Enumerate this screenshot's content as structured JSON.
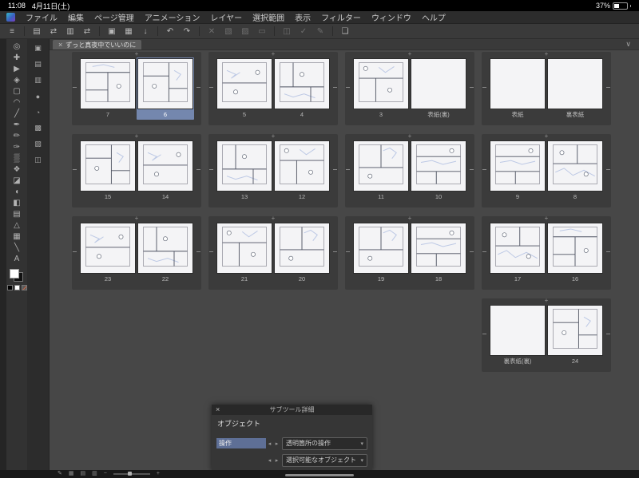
{
  "status_bar": {
    "time": "11:08",
    "date": "4月11日(土)",
    "battery": "37%"
  },
  "menu": {
    "items": [
      "ファイル",
      "編集",
      "ページ管理",
      "アニメーション",
      "レイヤー",
      "選択範囲",
      "表示",
      "フィルター",
      "ウィンドウ",
      "ヘルプ"
    ]
  },
  "toolbar": {
    "buttons": [
      {
        "name": "main-menu-button",
        "glyph": "≡"
      },
      {
        "sep": true
      },
      {
        "name": "spread-view-button",
        "glyph": "▤"
      },
      {
        "name": "change-page-order-button",
        "glyph": "⇄"
      },
      {
        "name": "single-page-view-button",
        "glyph": "▥"
      },
      {
        "name": "reverse-binding-button",
        "glyph": "⇄"
      },
      {
        "sep": true
      },
      {
        "name": "new-page-button",
        "glyph": "▣"
      },
      {
        "name": "import-page-button",
        "glyph": "▦"
      },
      {
        "name": "export-page-button",
        "glyph": "↓"
      },
      {
        "sep": true
      },
      {
        "name": "undo-button",
        "glyph": "↶"
      },
      {
        "name": "redo-button",
        "glyph": "↷"
      },
      {
        "sep": true
      },
      {
        "name": "clear-button",
        "glyph": "✕",
        "dim": true
      },
      {
        "name": "deselect-button",
        "glyph": "▧",
        "dim": true
      },
      {
        "name": "invert-selection-button",
        "glyph": "▨",
        "dim": true
      },
      {
        "name": "crop-button",
        "glyph": "▭",
        "dim": true
      },
      {
        "sep": true
      },
      {
        "name": "snap-to-ruler-button",
        "glyph": "◫",
        "dim": true
      },
      {
        "name": "correct-line-button",
        "glyph": "✓",
        "dim": true
      },
      {
        "name": "vector-edit-button",
        "glyph": "✎",
        "dim": true
      },
      {
        "sep": true
      },
      {
        "name": "material-palette-button",
        "glyph": "❏"
      }
    ]
  },
  "document_tab": {
    "close_glyph": "×",
    "title": "ずっと真夜中でいいのに"
  },
  "tools": {
    "primary": [
      {
        "name": "zoom-tool",
        "glyph": "◎"
      },
      {
        "name": "move-tool",
        "glyph": "✚"
      },
      {
        "name": "object-tool",
        "glyph": "▶"
      },
      {
        "name": "layer-select-tool",
        "glyph": "◈"
      },
      {
        "name": "selection-tool",
        "glyph": "▢"
      },
      {
        "name": "lasso-tool",
        "glyph": "◠"
      },
      {
        "name": "eyedropper-tool",
        "glyph": "╱"
      },
      {
        "name": "pen-tool",
        "glyph": "✒"
      },
      {
        "name": "pencil-tool",
        "glyph": "✏"
      },
      {
        "name": "brush-tool",
        "glyph": "✑"
      },
      {
        "name": "airbrush-tool",
        "glyph": "▒"
      },
      {
        "name": "decoration-tool",
        "glyph": "❖"
      },
      {
        "name": "eraser-tool",
        "glyph": "◪"
      },
      {
        "name": "blend-tool",
        "glyph": "◖"
      },
      {
        "name": "fill-tool",
        "glyph": "◧"
      },
      {
        "name": "gradient-tool",
        "glyph": "▤"
      },
      {
        "name": "figure-tool",
        "glyph": "△"
      },
      {
        "name": "frame-border-tool",
        "glyph": "▦"
      },
      {
        "name": "ruler-tool",
        "glyph": "╲"
      },
      {
        "name": "text-tool",
        "glyph": "A"
      }
    ],
    "palettes": [
      {
        "name": "quick-access-palette",
        "glyph": "▣"
      },
      {
        "name": "subtool-palette",
        "glyph": "▤"
      },
      {
        "name": "tool-property-palette",
        "glyph": "▥"
      },
      {
        "name": "brush-size-palette",
        "glyph": "●"
      },
      {
        "name": "color-wheel-palette",
        "glyph": "◔"
      },
      {
        "name": "color-set-palette",
        "glyph": "▩"
      },
      {
        "name": "layer-palette",
        "glyph": "▧"
      },
      {
        "name": "navigator-palette",
        "glyph": "◫"
      }
    ]
  },
  "page_manager": {
    "collapse_glyph": "∨",
    "selected_page": "6",
    "rows": [
      [
        {
          "pages": [
            {
              "label": "7"
            },
            {
              "label": "6",
              "selected": true
            }
          ]
        },
        {
          "pages": [
            {
              "label": "5"
            },
            {
              "label": "4"
            }
          ]
        },
        {
          "pages": [
            {
              "label": "3"
            },
            {
              "label": "表紙(裏)",
              "blank": true
            }
          ]
        },
        {
          "pages": [
            {
              "label": "表紙",
              "blank": true
            },
            {
              "label": "裏表紙",
              "blank": true
            }
          ]
        }
      ],
      [
        {
          "pages": [
            {
              "label": "15"
            },
            {
              "label": "14"
            }
          ]
        },
        {
          "pages": [
            {
              "label": "13"
            },
            {
              "label": "12"
            }
          ]
        },
        {
          "pages": [
            {
              "label": "11"
            },
            {
              "label": "10"
            }
          ]
        },
        {
          "pages": [
            {
              "label": "9"
            },
            {
              "label": "8"
            }
          ]
        }
      ],
      [
        {
          "pages": [
            {
              "label": "23"
            },
            {
              "label": "22"
            }
          ]
        },
        {
          "pages": [
            {
              "label": "21"
            },
            {
              "label": "20"
            }
          ]
        },
        {
          "pages": [
            {
              "label": "19"
            },
            {
              "label": "18"
            }
          ]
        },
        {
          "pages": [
            {
              "label": "17"
            },
            {
              "label": "16"
            }
          ]
        }
      ],
      [
        null,
        null,
        null,
        {
          "pages": [
            {
              "label": "裏表紙(裏)",
              "blank": true
            },
            {
              "label": "24"
            }
          ]
        }
      ]
    ]
  },
  "subtool_panel": {
    "title": "サブツール詳細",
    "close_glyph": "×",
    "section": "オブジェクト",
    "rows": [
      {
        "label": "操作",
        "active": true,
        "prev_glyph": "◂",
        "next_glyph": "▸",
        "dropdown": "透明箇所の操作",
        "arrow": "▾"
      },
      {
        "label": "",
        "active": false,
        "prev_glyph": "◂",
        "next_glyph": "▸",
        "dropdown": "選択可能なオブジェクト",
        "arrow": "▾"
      }
    ]
  },
  "bottom_bar": {
    "buttons": [
      {
        "name": "edit-page-button",
        "glyph": "✎"
      },
      {
        "name": "thumbnail-grid-button",
        "glyph": "▦"
      },
      {
        "name": "two-up-view-button",
        "glyph": "▤"
      },
      {
        "name": "list-view-button",
        "glyph": "▥"
      }
    ],
    "zoom_out": "−",
    "zoom_in": "+"
  },
  "colors": {
    "selection": "#7487ae",
    "page_bg": "#f4f4f6",
    "sketch_blue": "#b3c1e2",
    "panel_line": "#4c5160"
  }
}
